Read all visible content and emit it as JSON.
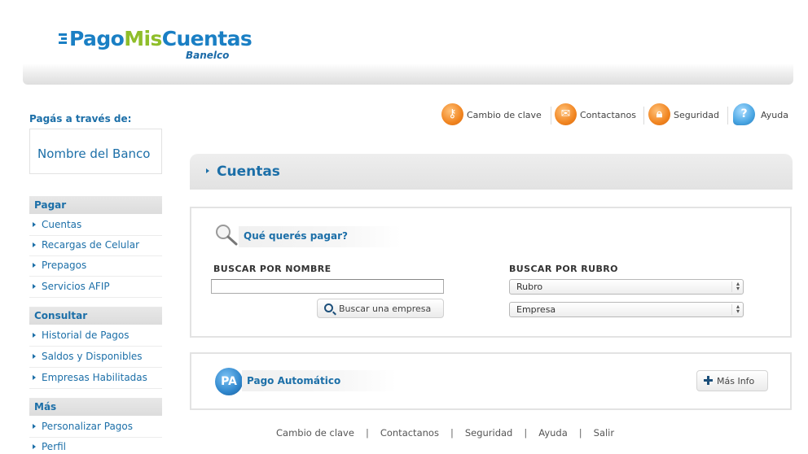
{
  "brand": {
    "logo_part1": "Pago",
    "logo_part2": "Mis",
    "logo_part3": "Cuentas",
    "sub": "Banelco",
    "primary_color": "#1a7fc4",
    "accent_color": "#8fbe2a"
  },
  "sidebar": {
    "pagas_label": "Pagás a través de:",
    "bank_name": "Nombre del Banco",
    "sections": [
      {
        "title": "Pagar",
        "items": [
          "Cuentas",
          "Recargas de Celular",
          "Prepagos",
          "Servicios AFIP"
        ]
      },
      {
        "title": "Consultar",
        "items": [
          "Historial de Pagos",
          "Saldos y Disponibles",
          "Empresas Habilitadas"
        ]
      },
      {
        "title": "Más",
        "items": [
          "Personalizar Pagos",
          "Perfil"
        ]
      }
    ]
  },
  "toplinks": {
    "cambio_clave": "Cambio de clave",
    "contactanos": "Contactanos",
    "seguridad": "Seguridad",
    "ayuda": "Ayuda"
  },
  "main": {
    "section_title": "Cuentas",
    "search": {
      "title": "Qué querés pagar?",
      "by_name_label": "BUSCAR POR NOMBRE",
      "name_value": "",
      "search_button": "Buscar una empresa",
      "by_rubro_label": "BUSCAR POR RUBRO",
      "rubro_selected": "Rubro",
      "empresa_selected": "Empresa"
    },
    "pago_automatico": {
      "badge": "PA",
      "title": "Pago Automático",
      "more_button": "Más Info"
    }
  },
  "footer": [
    "Cambio de clave",
    "Contactanos",
    "Seguridad",
    "Ayuda",
    "Salir"
  ]
}
